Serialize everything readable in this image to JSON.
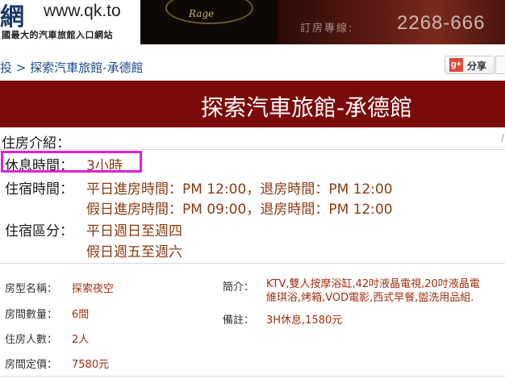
{
  "banner": {
    "logo_char": "網",
    "url": "www.qk.to",
    "tagline": "國最大的汽車旅館入口網站",
    "rage_text": "Rage",
    "phone_label": "訂房專線:",
    "phone_number": "2268-666"
  },
  "breadcrumb": {
    "parent": "投",
    "separator": ">",
    "current": "探索汽車旅館-承德館"
  },
  "share": {
    "icon_text": "g+",
    "label": "分享"
  },
  "title": "探索汽車旅館-承德館",
  "info": {
    "intro_label": "住房介紹：",
    "rest_label": "休息時間：",
    "rest_value": "3小時",
    "stay_label": "住宿時間：",
    "stay_weekday": "平日進房時間：PM 12:00，退房時間：PM 12:00",
    "stay_holiday": "假日進房時間：PM 09:00，退房時間：PM 12:00",
    "period_label": "住宿區分：",
    "period_weekday": "平日週日至週四",
    "period_holiday": "假日週五至週六"
  },
  "room": {
    "type_label": "房型名稱：",
    "type_value": "探索夜空",
    "count_label": "房間數量：",
    "count_value": "6間",
    "guests_label": "住房人數：",
    "guests_value": "2人",
    "price_label": "房間定價：",
    "price_value": "7580元",
    "intro_label": "簡介：",
    "intro_line1": "KTV,雙人按摩浴缸,42吋液晶電視,20吋液晶電",
    "intro_line2": "維琪浴,烤箱,VOD電影,西式早餐,盥洗用品組.",
    "note_label": "備註：",
    "note_value": "3H休息,1580元"
  },
  "colors": {
    "title_bar": "#7b0a0a",
    "highlight": "#e020d8",
    "link": "#1a4a8a",
    "value": "#8a3a10"
  }
}
